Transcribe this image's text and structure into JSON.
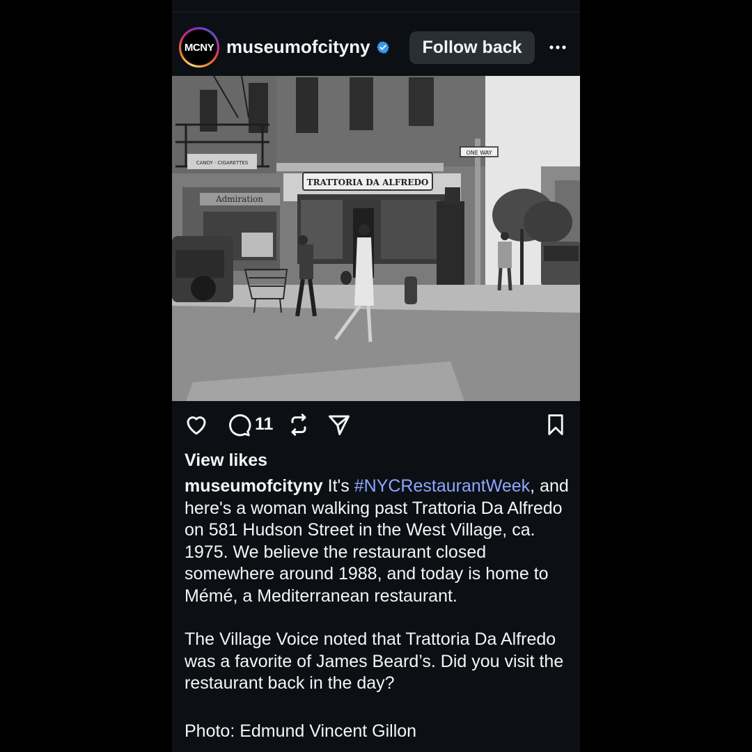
{
  "post": {
    "avatar_text": "MCNY",
    "username": "museumofcityny",
    "verified_icon": "verified-badge-icon",
    "follow_label": "Follow back",
    "more_icon": "more-options-icon",
    "photo": {
      "sign_name": "TRATTORIA DA ALFREDO",
      "sign_left": "Admiration",
      "sign_candy": "CANDY · CIGARETTES",
      "one_way": "ONE WAY"
    },
    "actions": {
      "like_icon": "heart-icon",
      "comment_icon": "comment-icon",
      "comment_count": "11",
      "repost_icon": "repost-icon",
      "share_icon": "share-icon",
      "save_icon": "bookmark-icon"
    },
    "view_likes": "View likes",
    "caption": {
      "username": "museumofcityny",
      "part1": " It's ",
      "hashtag": "#NYCRestaurantWeek",
      "part2": ", and here's a woman walking past Trattoria Da Alfredo on 581 Hudson Street in the West Village, ca. 1975. We believe the restaurant closed somewhere around 1988, and today is home to Mémé, a Mediterranean restaurant.",
      "paragraph2": "The Village Voice noted that Trattoria Da Alfredo was a favorite of James Beard’s. Did you visit the restaurant back in the day?",
      "paragraph3": "Photo: Edmund Vincent Gillon"
    }
  },
  "colors": {
    "background": "#000000",
    "panel": "#0c1014",
    "button": "#2a2f35",
    "hashtag": "#8ea6ff",
    "verified": "#3897f0"
  }
}
